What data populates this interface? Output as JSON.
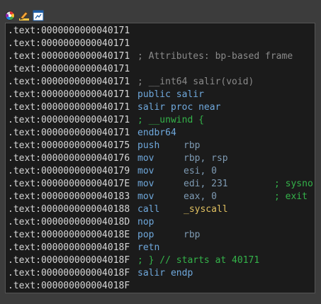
{
  "toolbar": {
    "buttons": [
      {
        "icon": "color-wheel-icon"
      },
      {
        "icon": "pencil-edit-icon"
      },
      {
        "icon": "graph-view-icon"
      }
    ]
  },
  "disasm": {
    "lines": [
      {
        "addr": ".text:0000000000040171",
        "text": ""
      },
      {
        "addr": ".text:0000000000040171",
        "text": ""
      },
      {
        "addr": ".text:0000000000040171",
        "comment": "; Attributes: bp-based frame"
      },
      {
        "addr": ".text:0000000000040171",
        "text": ""
      },
      {
        "addr": ".text:0000000000040171",
        "comment": "; __int64 salir(void)"
      },
      {
        "addr": ".text:0000000000040171",
        "text": "public salir"
      },
      {
        "addr": ".text:0000000000040171",
        "text": "salir proc near"
      },
      {
        "addr": ".text:0000000000040171",
        "green": "; __unwind {"
      },
      {
        "addr": ".text:0000000000040171",
        "mnemonic": "endbr64",
        "operand": ""
      },
      {
        "addr": ".text:0000000000040175",
        "mnemonic": "push",
        "operand": "rbp"
      },
      {
        "addr": ".text:0000000000040176",
        "mnemonic": "mov",
        "operand": "rbp, rsp"
      },
      {
        "addr": ".text:0000000000040179",
        "mnemonic": "mov",
        "operand": "esi, 0"
      },
      {
        "addr": ".text:000000000004017E",
        "mnemonic": "mov",
        "operand": "edi, 231",
        "comment": "; sysno"
      },
      {
        "addr": ".text:0000000000040183",
        "mnemonic": "mov",
        "operand": "eax, 0",
        "comment": "; exit"
      },
      {
        "addr": ".text:0000000000040188",
        "mnemonic": "call",
        "operand": "_syscall"
      },
      {
        "addr": ".text:000000000004018D",
        "mnemonic": "nop",
        "operand": ""
      },
      {
        "addr": ".text:000000000004018E",
        "mnemonic": "pop",
        "operand": "rbp"
      },
      {
        "addr": ".text:000000000004018F",
        "mnemonic": "retn",
        "operand": ""
      },
      {
        "addr": ".text:000000000004018F",
        "green": "; } // starts at 40171"
      },
      {
        "addr": ".text:000000000004018F",
        "text": "salir endp"
      },
      {
        "addr": ".text:000000000004018F",
        "text": ""
      }
    ]
  }
}
